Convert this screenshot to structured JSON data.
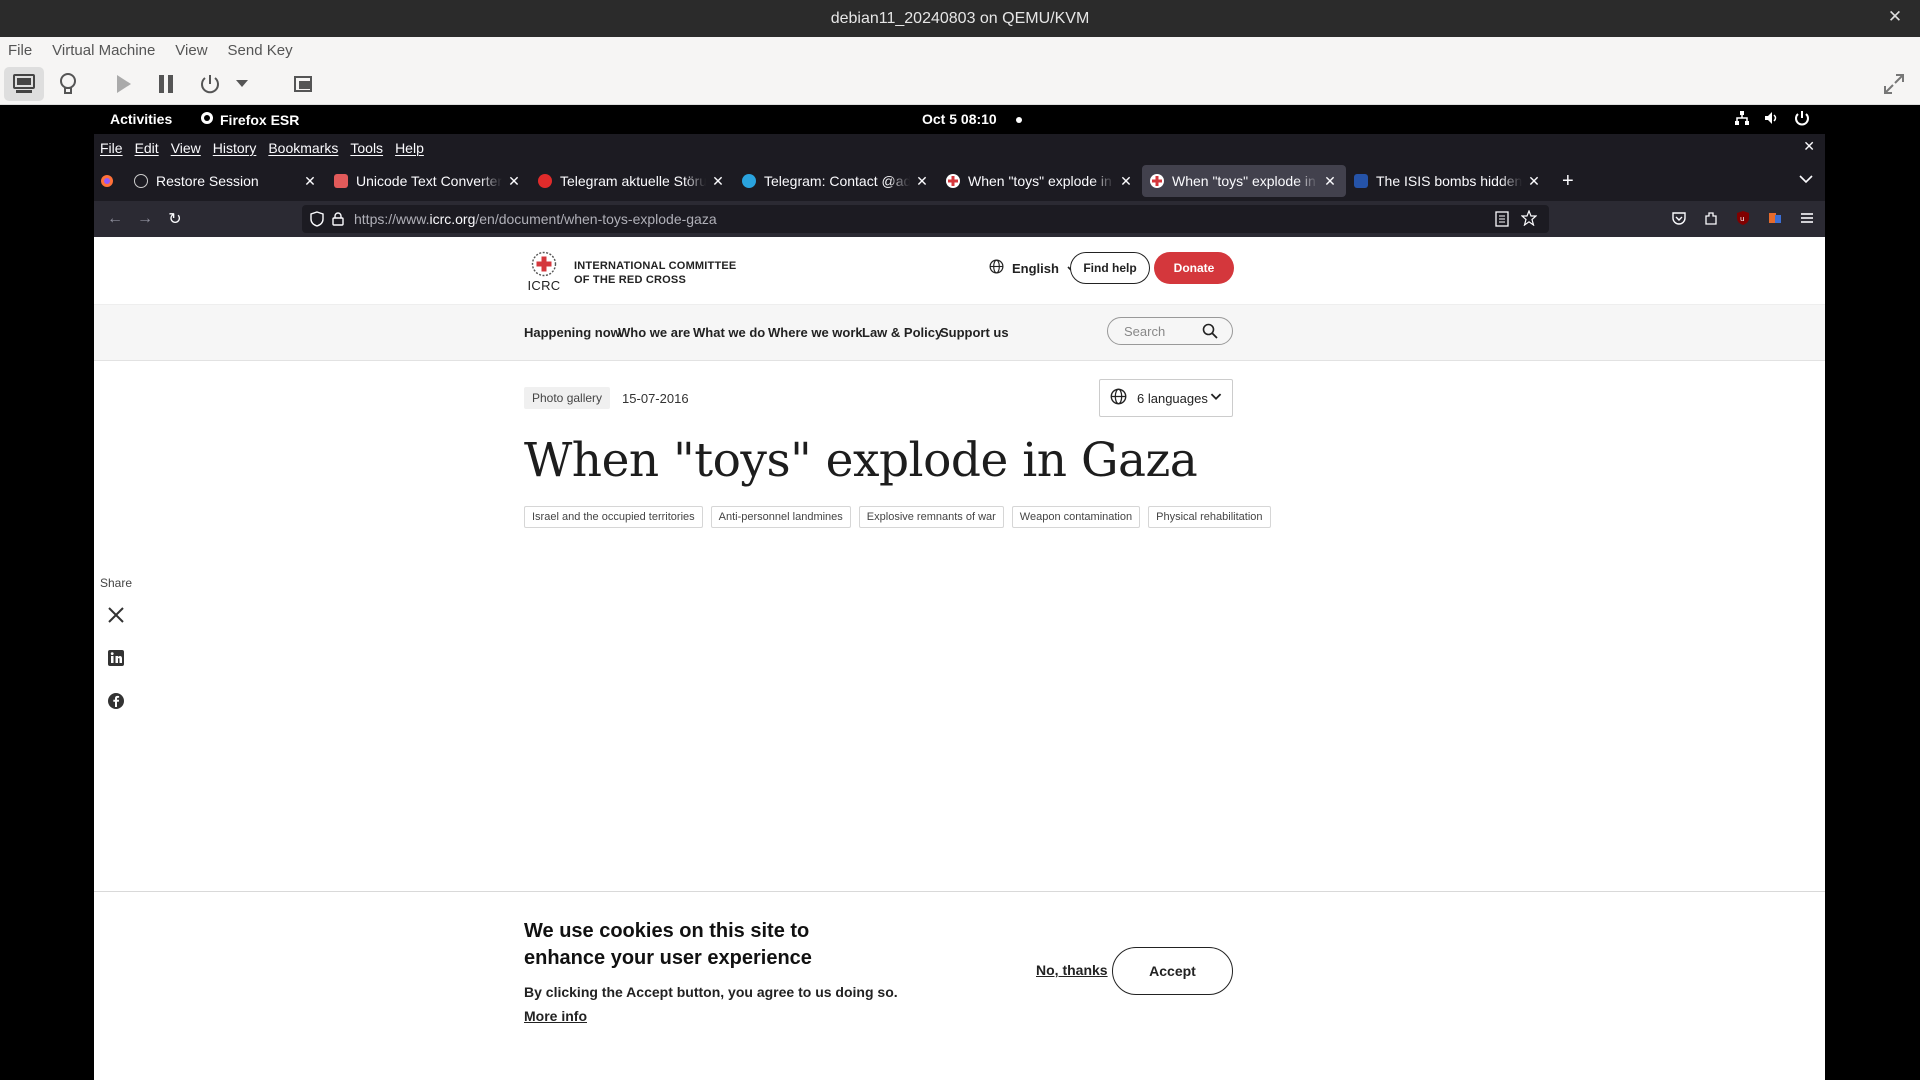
{
  "vm": {
    "title": "debian11_20240803 on QEMU/KVM",
    "menu": [
      "File",
      "Virtual Machine",
      "View",
      "Send Key"
    ]
  },
  "gnome": {
    "activities": "Activities",
    "app_name": "Firefox ESR",
    "clock": "Oct 5  08:10"
  },
  "firefox": {
    "menu": [
      "File",
      "Edit",
      "View",
      "History",
      "Bookmarks",
      "Tools",
      "Help"
    ],
    "tabs": [
      {
        "title": "Restore Session",
        "favicon_color": "#aaaaaa"
      },
      {
        "title": "Unicode Text Converter -",
        "favicon_color": "#e15a5a"
      },
      {
        "title": "Telegram aktuelle Störun",
        "favicon_color": "#e02b2b"
      },
      {
        "title": "Telegram: Contact @adh",
        "favicon_color": "#2aa3de"
      },
      {
        "title": "When \"toys\" explode in G",
        "favicon_color": "#d4373c"
      },
      {
        "title": "When \"toys\" explode in G",
        "favicon_color": "#d4373c"
      },
      {
        "title": "The ISIS bombs hidden in",
        "favicon_color": "#2553a8"
      }
    ],
    "url": {
      "prefix": "https://www.",
      "host": "icrc.org",
      "path": "/en/document/when-toys-explode-gaza"
    }
  },
  "site": {
    "logo_acronym": "ICRC",
    "logo_line1": "INTERNATIONAL COMMITTEE",
    "logo_line2": "OF THE RED CROSS",
    "language": "English",
    "find_help": "Find help",
    "donate": "Donate",
    "nav": [
      "Happening now",
      "Who we are",
      "What we do",
      "Where we work",
      "Law & Policy",
      "Support us"
    ],
    "search_placeholder": "Search"
  },
  "article": {
    "type": "Photo gallery",
    "date": "15-07-2016",
    "languages": "6 languages",
    "title": "When \"toys\" explode in Gaza",
    "tags": [
      "Israel and the occupied territories",
      "Anti-personnel landmines",
      "Explosive remnants of war",
      "Weapon contamination",
      "Physical rehabilitation"
    ]
  },
  "share": {
    "label": "Share"
  },
  "cookie": {
    "heading": "We use cookies on this site to enhance your user experience",
    "description": "By clicking the Accept button, you agree to us doing so.",
    "more_info": "More info",
    "no_thanks": "No, thanks",
    "accept": "Accept"
  }
}
